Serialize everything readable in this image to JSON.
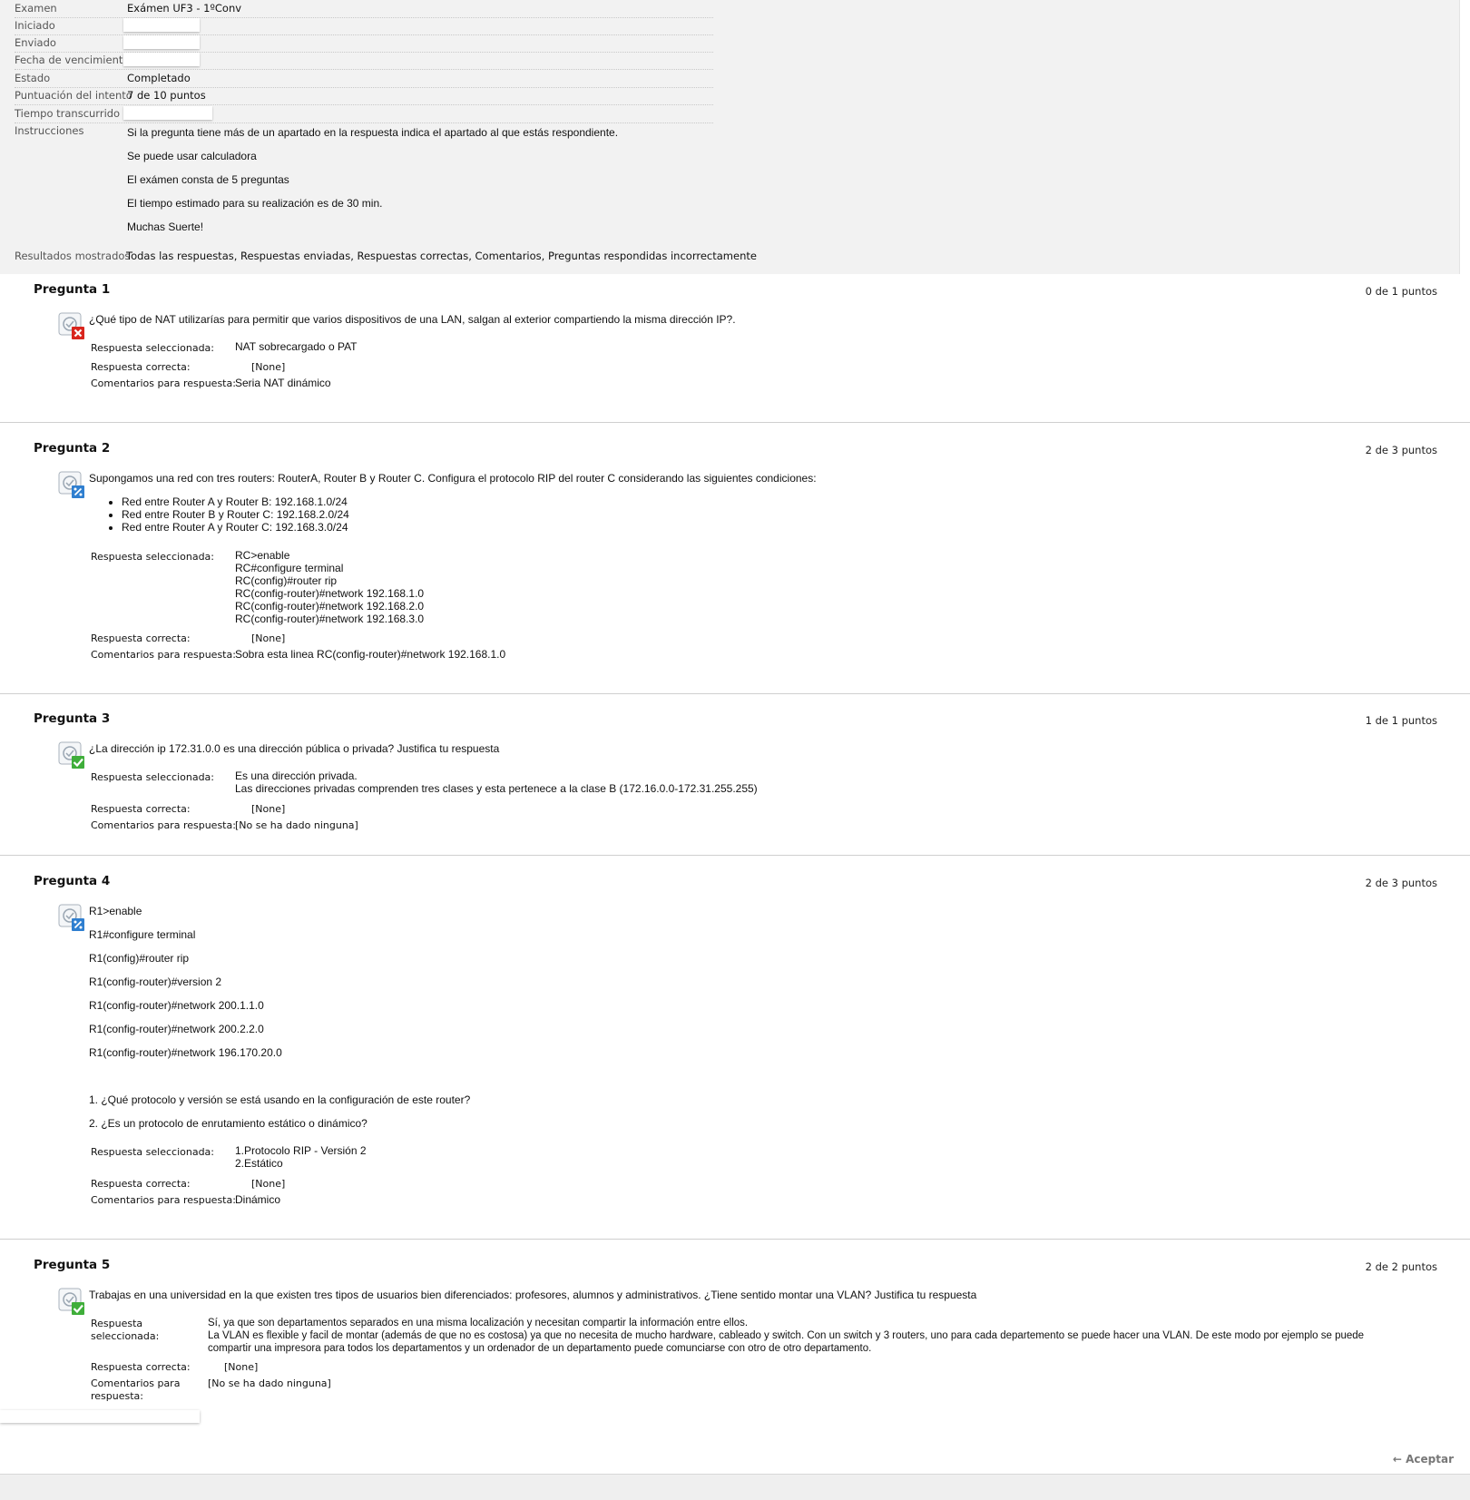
{
  "summary": {
    "examen_label": "Examen",
    "examen_value": "Exámen UF3 - 1ºConv",
    "iniciado_label": "Iniciado",
    "enviado_label": "Enviado",
    "vencimiento_label": "Fecha de vencimiento",
    "estado_label": "Estado",
    "estado_value": "Completado",
    "puntuacion_label": "Puntuación del intento",
    "puntuacion_value": "7 de 10 puntos",
    "tiempo_label": "Tiempo transcurrido",
    "instrucciones_label": "Instrucciones",
    "instrucciones": [
      "Si la pregunta tiene más de un apartado en la respuesta indica el apartado al que estás respondiente.",
      "Se puede usar calculadora",
      "El exámen consta de 5 preguntas",
      "El tiempo estimado para su realización es de 30 min.",
      "Muchas Suerte!"
    ],
    "resultados_label": "Resultados mostrados",
    "resultados_value": "Todas las respuestas, Respuestas enviadas, Respuestas correctas, Comentarios, Preguntas respondidas incorrectamente"
  },
  "labels": {
    "seleccionada": "Respuesta seleccionada:",
    "correcta": "Respuesta correcta:",
    "comentarios": "Comentarios para respuesta:",
    "seleccionada_a": "Respuesta",
    "seleccionada_b": "seleccionada:",
    "comentarios_a": "Comentarios para",
    "comentarios_b": "respuesta:",
    "none": "[None]"
  },
  "questions": [
    {
      "title": "Pregunta 1",
      "points": "0 de 1 puntos",
      "status": "incorrect",
      "text": "¿Qué tipo de NAT utilizarías para permitir que varios dispositivos de una LAN, salgan al exterior compartiendo la misma dirección IP?.",
      "selected": "NAT sobrecargado o PAT",
      "comment": "Seria NAT dinámico"
    },
    {
      "title": "Pregunta 2",
      "points": "2 de 3 puntos",
      "status": "partial",
      "text": "Supongamos una red con tres routers: RouterA, Router B y Router C. Configura el protocolo RIP del router C considerando las siguientes condiciones:",
      "bullets": [
        "Red entre Router A y Router B: 192.168.1.0/24",
        "Red entre Router B y Router C: 192.168.2.0/24",
        "Red entre Router A y Router C: 192.168.3.0/24"
      ],
      "selected_lines": [
        "RC>enable",
        "RC#configure terminal",
        "RC(config)#router rip",
        "RC(config-router)#network 192.168.1.0",
        "RC(config-router)#network 192.168.2.0",
        "RC(config-router)#network 192.168.3.0"
      ],
      "comment": "Sobra esta linea RC(config-router)#network 192.168.1.0"
    },
    {
      "title": "Pregunta 3",
      "points": "1 de 1 puntos",
      "status": "correct",
      "text": "¿La dirección ip 172.31.0.0 es una dirección pública o privada? Justifica tu respuesta",
      "selected_lines": [
        "Es una dirección privada.",
        "Las direcciones privadas comprenden tres clases y esta pertenece a la clase B (172.16.0.0-172.31.255.255)"
      ],
      "comment": "[No se ha dado ninguna]"
    },
    {
      "title": "Pregunta 4",
      "points": "2 de 3 puntos",
      "status": "partial",
      "text_lines": [
        "R1>enable",
        "R1#configure terminal",
        "R1(config)#router rip",
        "R1(config-router)#version 2",
        "R1(config-router)#network 200.1.1.0",
        "R1(config-router)#network 200.2.2.0",
        "R1(config-router)#network 196.170.20.0"
      ],
      "questions_lines": [
        "1. ¿Qué protocolo y versión se está usando en la configuración de este router?",
        "2. ¿Es un protocolo de enrutamiento estático o dinámico?"
      ],
      "selected_lines": [
        "1.Protocolo RIP - Versión 2",
        "2.Estático"
      ],
      "comment": "Dinámico"
    },
    {
      "title": "Pregunta 5",
      "points": "2 de 2 puntos",
      "status": "correct",
      "text": "Trabajas en una universidad en la que existen tres tipos de usuarios bien diferenciados: profesores, alumnos y administrativos. ¿Tiene sentido montar una VLAN? Justifica tu respuesta",
      "selected_lines": [
        "Sí, ya que son departamentos separados en una misma localización y necesitan compartir la información entre ellos.",
        "La VLAN es flexible y facil de montar (además de que no es costosa) ya que no necesita de mucho hardware, cableado y switch. Con un switch y 3 routers, uno para cada departemento se puede hacer una VLAN. De este modo por ejemplo se puede",
        "compartir una impresora para todos los departamentos y un ordenador de un departamento puede comunciarse con otro de otro departamento."
      ],
      "comment": "[No se ha dado ninguna]"
    }
  ],
  "footer": {
    "accept_label": "← Aceptar"
  },
  "colors": {
    "incorrect": "#d9251d",
    "correct": "#3fae3a",
    "partial": "#2f7fd0"
  },
  "icons": {
    "incorrect": "incorrect-x-icon",
    "correct": "correct-check-icon",
    "partial": "partial-credit-icon"
  }
}
